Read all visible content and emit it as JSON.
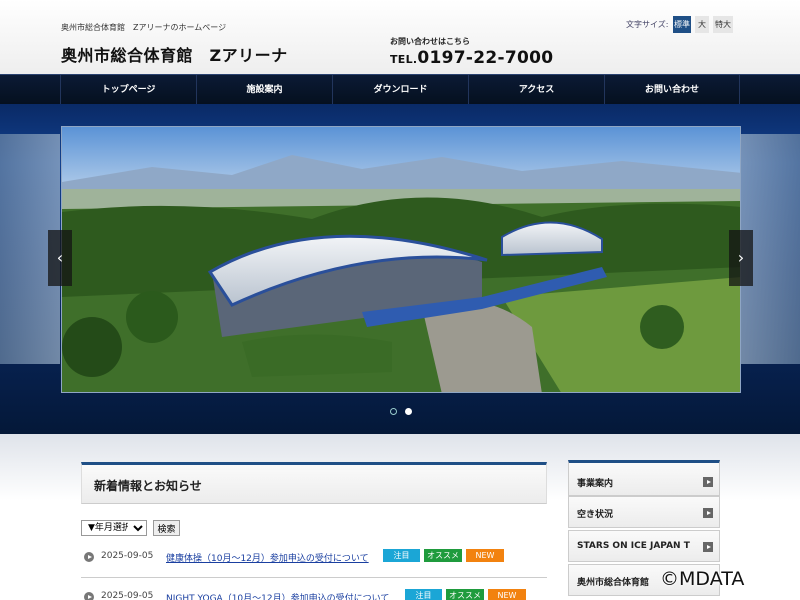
{
  "header": {
    "tagline": "奥州市総合体育館　Zアリーナのホームページ",
    "site_title": "奥州市総合体育館　Zアリーナ",
    "contact_label": "お問い合わせはこちら",
    "phone_prefix": "TEL.",
    "phone_number": "0197-22-7000",
    "font_size": {
      "label": "文字サイズ:",
      "options": [
        "標準",
        "大",
        "特大"
      ],
      "selected": "標準"
    }
  },
  "nav": {
    "items": [
      "トップページ",
      "施設案内",
      "ダウンロード",
      "アクセス",
      "お問い合わせ"
    ]
  },
  "slider": {
    "prev_icon": "‹",
    "next_icon": "›",
    "slide_count": 2,
    "active_slide": 2
  },
  "news": {
    "heading": "新着情報とお知らせ",
    "filter_select": "▼年月選択",
    "search_button": "検索",
    "items": [
      {
        "date": "2025-09-05",
        "title": "健康体操（10月～12月）参加申込の受付について",
        "tags": [
          "注目",
          "オススメ",
          "NEW"
        ]
      },
      {
        "date": "2025-09-05",
        "title": "NIGHT YOGA（10月～12月）参加申込の受付について",
        "tags": [
          "注目",
          "オススメ",
          "NEW"
        ]
      }
    ]
  },
  "sidebar": {
    "items": [
      "事業案内",
      "空き状況",
      "STARS ON ICE JAPAN T",
      "奥州市総合体育館"
    ]
  },
  "watermark": "©MDATA",
  "colors": {
    "accent": "#1f4f86",
    "tag_blue": "#1ba6d6",
    "tag_green": "#1f9b3d",
    "tag_orange": "#f2820f",
    "link": "#1a3fa0"
  }
}
